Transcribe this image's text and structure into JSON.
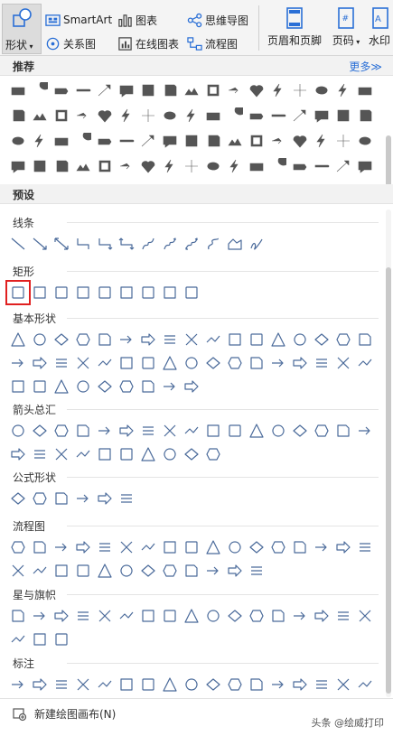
{
  "ribbon": {
    "shape_label": "形状",
    "smartart_label": "SmartArt",
    "chart_label": "图表",
    "mindmap_label": "思维导图",
    "relation_label": "关系图",
    "online_chart_label": "在线图表",
    "flowchart_label": "流程图",
    "header_footer_label": "页眉和页脚",
    "page_number_label": "页码",
    "watermark_label": "水印"
  },
  "panel": {
    "recommended_title": "推荐",
    "more_label": "更多≫",
    "preset_title": "预设",
    "sections": [
      {
        "key": "lines",
        "label": "线条"
      },
      {
        "key": "rect",
        "label": "矩形"
      },
      {
        "key": "basic",
        "label": "基本形状"
      },
      {
        "key": "arrows",
        "label": "箭头总汇"
      },
      {
        "key": "formula",
        "label": "公式形状"
      },
      {
        "key": "flow",
        "label": "流程图"
      },
      {
        "key": "stars",
        "label": "星与旗帜"
      },
      {
        "key": "callouts",
        "label": "标注"
      }
    ],
    "new_canvas_label": "新建绘图画布(N)",
    "watermark_text": "头条 @绘威打印"
  },
  "colors": {
    "accent": "#2a6fd6",
    "icon_fill": "#555555",
    "outline": "#4a6a9a",
    "selection": "#e02020"
  }
}
